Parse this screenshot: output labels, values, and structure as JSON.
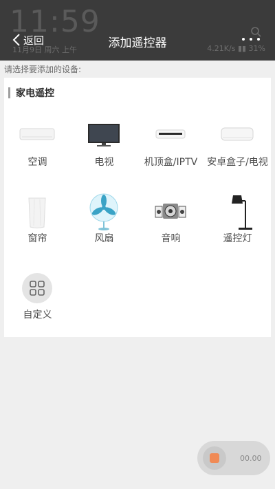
{
  "status": {
    "time": "11:59",
    "date": "11月9日 周六 上午",
    "network": "4.21K/s",
    "battery": "31%"
  },
  "header": {
    "back_label": "返回",
    "title": "添加遥控器"
  },
  "hint": "请选择要添加的设备:",
  "section": {
    "title": "家电遥控"
  },
  "devices": [
    {
      "label": "空调",
      "icon": "air-conditioner-icon"
    },
    {
      "label": "电视",
      "icon": "tv-icon"
    },
    {
      "label": "机顶盒/IPTV",
      "icon": "set-top-box-icon"
    },
    {
      "label": "安卓盒子/电视",
      "icon": "android-box-icon"
    },
    {
      "label": "窗帘",
      "icon": "curtain-icon"
    },
    {
      "label": "风扇",
      "icon": "fan-icon"
    },
    {
      "label": "音响",
      "icon": "speaker-icon"
    },
    {
      "label": "遥控灯",
      "icon": "lamp-icon"
    },
    {
      "label": "自定义",
      "icon": "custom-grid-icon"
    }
  ],
  "recorder": {
    "time": "00.00",
    "accent": "#f08a55"
  }
}
